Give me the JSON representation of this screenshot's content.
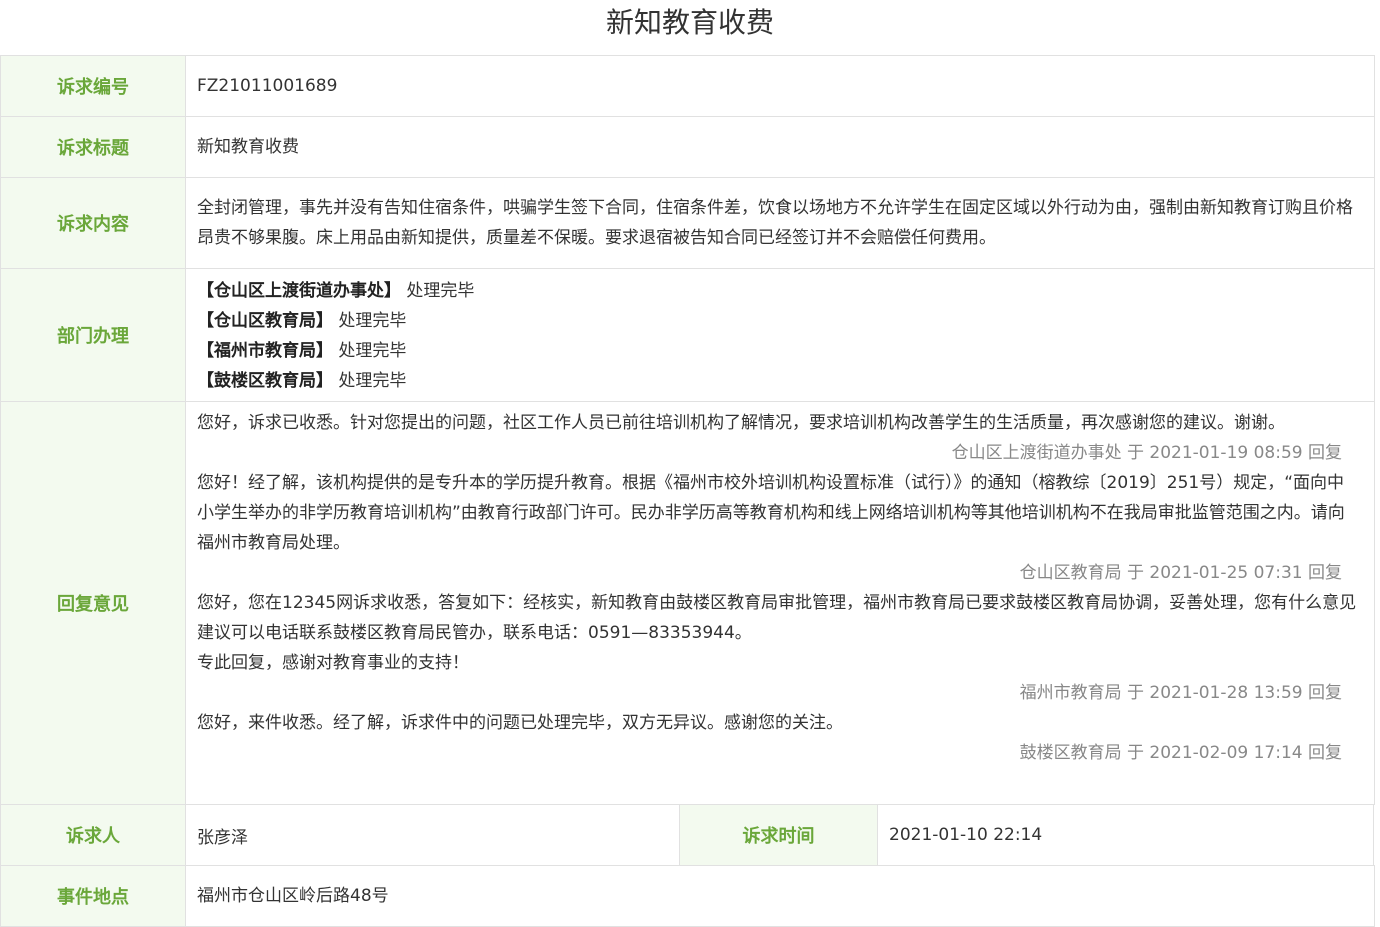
{
  "page_title": "新知教育收费",
  "colors": {
    "label_bg": "#f3faef",
    "label_text": "#6aa73a",
    "border": "#e1e1e1",
    "meta_text": "#888888"
  },
  "fields": {
    "id": {
      "label": "诉求编号",
      "value": "FZ21011001689"
    },
    "title": {
      "label": "诉求标题",
      "value": "新知教育收费"
    },
    "content": {
      "label": "诉求内容",
      "value": "全封闭管理，事先并没有告知住宿条件，哄骗学生签下合同，住宿条件差，饮食以场地方不允许学生在固定区域以外行动为由，强制由新知教育订购且价格昂贵不够果腹。床上用品由新知提供，质量差不保暖。要求退宿被告知合同已经签订并不会赔偿任何费用。"
    },
    "departments": {
      "label": "部门办理",
      "items": [
        {
          "name": "【仓山区上渡街道办事处】",
          "status": "处理完毕"
        },
        {
          "name": "【仓山区教育局】",
          "status": "处理完毕"
        },
        {
          "name": "【福州市教育局】",
          "status": "处理完毕"
        },
        {
          "name": "【鼓楼区教育局】",
          "status": "处理完毕"
        }
      ]
    },
    "replies": {
      "label": "回复意见",
      "items": [
        {
          "text": "您好，诉求已收悉。针对您提出的问题，社区工作人员已前往培训机构了解情况，要求培训机构改善学生的生活质量，再次感谢您的建议。谢谢。",
          "meta": "仓山区上渡街道办事处 于 2021-01-19 08:59 回复"
        },
        {
          "text": "您好！经了解，该机构提供的是专升本的学历提升教育。根据《福州市校外培训机构设置标准（试行）》的通知（榕教综〔2019〕251号）规定，“面向中小学生举办的非学历教育培训机构”由教育行政部门许可。民办非学历高等教育机构和线上网络培训机构等其他培训机构不在我局审批监管范围之内。请向福州市教育局处理。",
          "meta": "仓山区教育局 于 2021-01-25 07:31 回复"
        },
        {
          "text": "您好，您在12345网诉求收悉，答复如下：经核实，新知教育由鼓楼区教育局审批管理，福州市教育局已要求鼓楼区教育局协调，妥善处理，您有什么意见建议可以电话联系鼓楼区教育局民管办，联系电话：0591—83353944。",
          "text2": "专此回复，感谢对教育事业的支持！",
          "meta": "福州市教育局 于 2021-01-28 13:59 回复"
        },
        {
          "text": "您好，来件收悉。经了解，诉求件中的问题已处理完毕，双方无异议。感谢您的关注。",
          "meta": "鼓楼区教育局 于 2021-02-09 17:14 回复"
        }
      ]
    },
    "petitioner": {
      "label": "诉求人",
      "value": "张彦泽"
    },
    "time": {
      "label": "诉求时间",
      "value": "2021-01-10 22:14"
    },
    "location": {
      "label": "事件地点",
      "value": "福州市仓山区岭后路48号"
    }
  }
}
